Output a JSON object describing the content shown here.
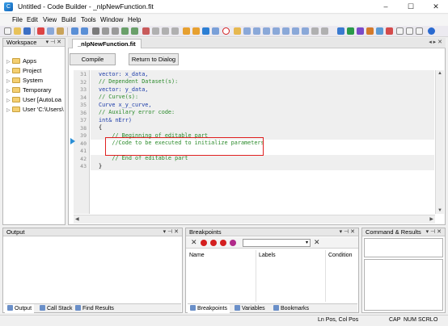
{
  "window": {
    "title": "Untitled - Code Builder - _nlpNewFunction.fit",
    "controls": {
      "minimize": "–",
      "maximize": "☐",
      "close": "✕"
    }
  },
  "menu": [
    "File",
    "Edit",
    "View",
    "Build",
    "Tools",
    "Window",
    "Help"
  ],
  "workspace": {
    "title": "Workspace",
    "items": [
      "Apps",
      "Project",
      "System",
      "Temporary",
      "User [AutoLoa",
      "User 'C:\\Users\\"
    ]
  },
  "editor": {
    "tab": "_nlpNewFunction.fit",
    "buttons": {
      "compile": "Compile",
      "return": "Return to Dialog"
    },
    "lines": [
      {
        "n": "31",
        "text": "vector: x_data,"
      },
      {
        "n": "32",
        "text": "// Dependent Dataset(s):"
      },
      {
        "n": "33",
        "text": "vector: y_data,"
      },
      {
        "n": "34",
        "text": "// Curve(s):"
      },
      {
        "n": "35",
        "text": "Curve x_y_curve,"
      },
      {
        "n": "36",
        "text": "// Auxilary error code:"
      },
      {
        "n": "37",
        "text": "int& nErr)"
      },
      {
        "n": "38",
        "text": "{"
      },
      {
        "n": "39",
        "text": "    // Beginning of editable part"
      },
      {
        "n": "40",
        "text": "    //Code to be executed to initialize parameters"
      },
      {
        "n": "41",
        "text": ""
      },
      {
        "n": "42",
        "text": "    // End of editable part"
      },
      {
        "n": "43",
        "text": "}"
      }
    ]
  },
  "output": {
    "title": "Output",
    "tabs": [
      "Output",
      "Call Stack",
      "Find Results"
    ]
  },
  "breakpoints": {
    "title": "Breakpoints",
    "columns": [
      "Name",
      "Labels",
      "Condition"
    ],
    "tabs": [
      "Breakpoints",
      "Variables",
      "Bookmarks"
    ]
  },
  "command": {
    "title": "Command & Results"
  },
  "status": {
    "position": "Ln Pos, Col Pos",
    "indicators": [
      "CAP",
      "NUM",
      "SCRL",
      "O"
    ]
  }
}
